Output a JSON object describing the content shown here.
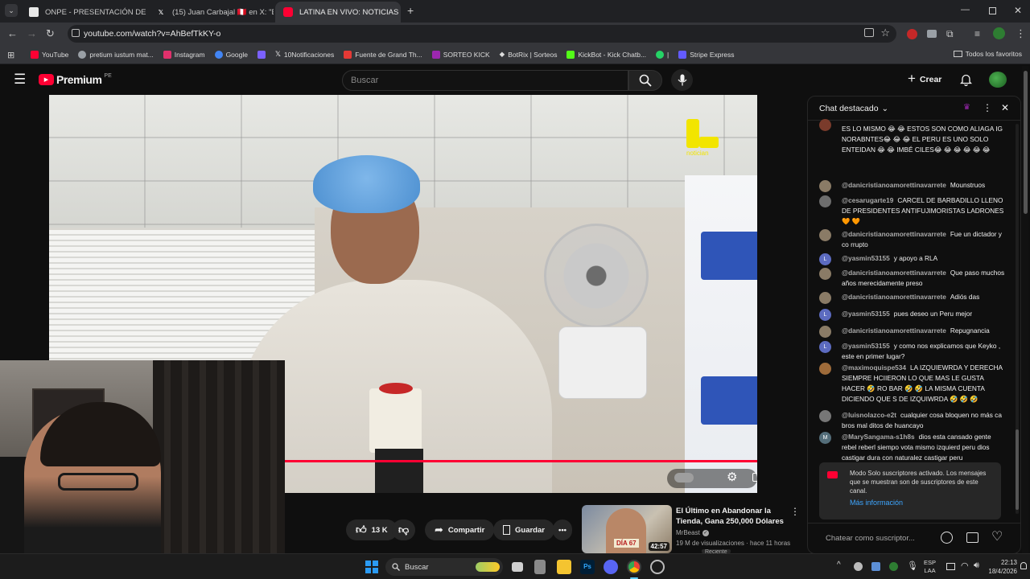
{
  "browser": {
    "tabs": [
      {
        "title": "ONPE - PRESENTACIÓN DE RES",
        "favicon_color": "#e8e8e8"
      },
      {
        "title": "(15) Juan Carbajal 🇵🇪 en X: \"El JU",
        "favicon_color": "#ffffff"
      },
      {
        "title": "LATINA EN VIVO: NOTICIAS",
        "favicon_color": "#ff0033"
      }
    ],
    "new_tab_label": "+",
    "url": "youtube.com/watch?v=AhBefTkKY-o",
    "bookmarks": [
      {
        "label": "YouTube",
        "color": "#ff0033"
      },
      {
        "label": "pretium iustum mat...",
        "color": "#9aa0a6"
      },
      {
        "label": "Instagram",
        "color": "#e1306c"
      },
      {
        "label": "Google",
        "color": "#4285f4"
      },
      {
        "label": "",
        "color": "#7b61ff"
      },
      {
        "label": "10Notificaciones",
        "color": "#ffffff"
      },
      {
        "label": "Fuente de Grand Th...",
        "color": "#e53935"
      },
      {
        "label": "SORTEO KICK",
        "color": "#9c27b0"
      },
      {
        "label": "BotRix | Sorteos",
        "color": "#ffffff"
      },
      {
        "label": "KickBot - Kick Chatb...",
        "color": "#53fc18"
      },
      {
        "label": "|",
        "color": "#25d366"
      },
      {
        "label": "Stripe Express",
        "color": "#635bff"
      }
    ],
    "all_bookmarks_label": "Todos los favoritos"
  },
  "youtube": {
    "logo_text": "Premium",
    "region": "PE",
    "search_placeholder": "Buscar",
    "create_label": "Crear",
    "watermark_text": "notician"
  },
  "video": {
    "progress": 1.0,
    "actions": {
      "likes": "13 K",
      "share": "Compartir",
      "save": "Guardar"
    }
  },
  "recommended": {
    "title": "El Último en Abandonar la Tienda, Gana 250,000 Dólares",
    "channel": "MrBeast",
    "meta": "19 M de visualizaciones · hace 11 horas",
    "duration": "42:57",
    "thumb_text": "DÍA 67",
    "badge": "Reciente"
  },
  "chat": {
    "title": "Chat destacado",
    "messages": [
      {
        "author": "",
        "text": "ES LO MISMO 😂 😂 ESTOS SON COMO ALIAGA IG NORABNTES😂 😂 😂 EL PERU ES UNO SOLO ENTEIDAN 😂 😂 IMBÉ CILES😂 😂 😂 😂 😂 😂",
        "avatar": "#7a3b2b"
      },
      {
        "author": "@danicristianoamorettinavarrete",
        "text": "Mounstruos",
        "avatar": "#8a7b66"
      },
      {
        "author": "@cesarugarte19",
        "text": "CARCEL DE BARBADILLO LLENO DE PRESIDENTES ANTIFUJIMORISTAS LADRONES 🧡 🧡",
        "avatar": "#6d6d6d"
      },
      {
        "author": "@danicristianoamorettinavarrete",
        "text": "Fue un dictador y co rrupto",
        "avatar": "#8a7b66"
      },
      {
        "author": "@yasmin53155",
        "text": "y apoyo a RLA",
        "avatar": "#5c6bc0",
        "initial": "L"
      },
      {
        "author": "@danicristianoamorettinavarrete",
        "text": "Que paso muchos años merecidamente preso",
        "avatar": "#8a7b66"
      },
      {
        "author": "@danicristianoamorettinavarrete",
        "text": "Adiós das",
        "avatar": "#8a7b66"
      },
      {
        "author": "@yasmin53155",
        "text": "pues deseo un Peru mejor",
        "avatar": "#5c6bc0",
        "initial": "L"
      },
      {
        "author": "@danicristianoamorettinavarrete",
        "text": "Repugnancia",
        "avatar": "#8a7b66"
      },
      {
        "author": "@yasmin53155",
        "text": "y como nos explicamos que Keyko , este en primer lugar?",
        "avatar": "#5c6bc0",
        "initial": "L"
      },
      {
        "author": "@maximoquispe534",
        "text": "LA IZQUIEWRDA Y DERECHA SIEMPRE HCIIERON LO QUE MAS LE GUSTA HACER 🤣 RO BAR 🤣 🤣 LA MISMA CUENTA DICIENDO QUE S DE IZQUIWRDA 🤣 🤣 🤣",
        "avatar": "#9e6b3a"
      },
      {
        "author": "@luisnolazco-e2t",
        "text": "cualquier cosa bloquen no más ca bros mal ditos de huancayo",
        "avatar": "#777777"
      },
      {
        "author": "@MarySangama-s1h8s",
        "text": "dios esta cansado gente rebel reberl siempo vota mismo izquierd peru dios castigar dura con naturalez castigar peru",
        "avatar": "#546e7a",
        "initial": "M"
      }
    ],
    "notice": {
      "text": "Modo Solo suscriptores activado. Los mensajes que se muestran son de suscriptores de este canal.",
      "link": "Más información"
    },
    "input_placeholder": "Chatear como suscriptor..."
  },
  "taskbar": {
    "search_label": "Buscar",
    "lang": "ESP",
    "lang_sub": "LAA",
    "time": "22:13",
    "date": "18/4/2026"
  }
}
